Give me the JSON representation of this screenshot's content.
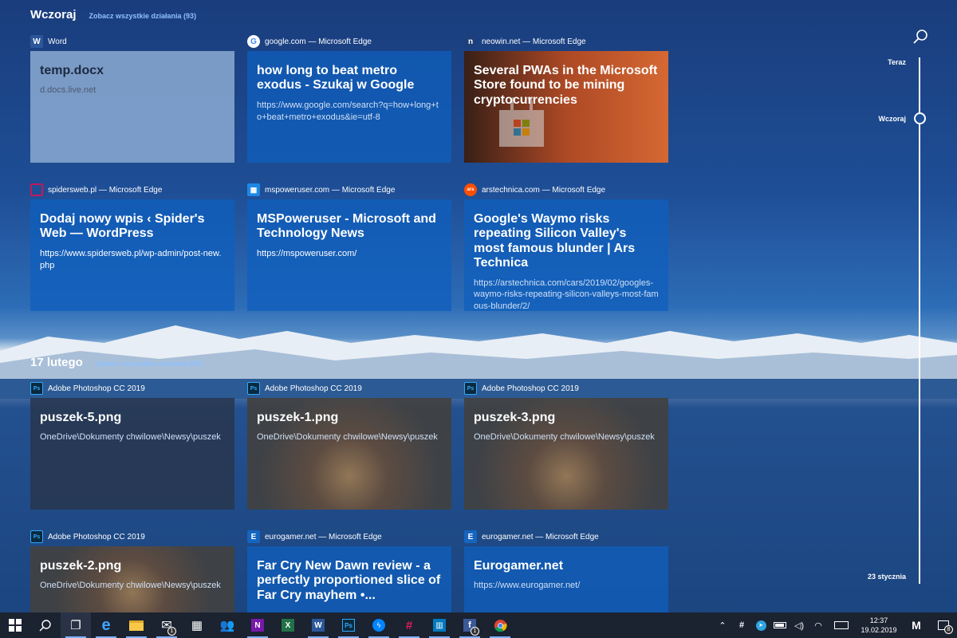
{
  "sections": [
    {
      "title": "Wczoraj",
      "see_all": "Zobacz wszystkie działania (93)"
    },
    {
      "title": "17 lutego",
      "see_all": "Zobacz wszystkie działania (50)"
    }
  ],
  "cards": [
    {
      "app": "Word",
      "title": "temp.docx",
      "sub": "d.docs.live.net"
    },
    {
      "app": "google.com — Microsoft Edge",
      "title": "how long to beat metro exodus - Szukaj w Google",
      "sub": "https://www.google.com/search?q=how+long+to+beat+metro+exodus&ie=utf-8"
    },
    {
      "app": "neowin.net — Microsoft Edge",
      "title": "Several PWAs in the Microsoft Store found to be mining cryptocurrencies",
      "sub": ""
    },
    {
      "app": "spidersweb.pl — Microsoft Edge",
      "title": "Dodaj nowy wpis ‹ Spider's Web — WordPress",
      "sub": "https://www.spidersweb.pl/wp-admin/post-new.php"
    },
    {
      "app": "mspoweruser.com — Microsoft Edge",
      "title": "MSPoweruser - Microsoft and Technology News",
      "sub": "https://mspoweruser.com/"
    },
    {
      "app": "arstechnica.com — Microsoft Edge",
      "title": "Google's Waymo risks repeating Silicon Valley's most famous blunder | Ars Technica",
      "sub": "https://arstechnica.com/cars/2019/02/googles-waymo-risks-repeating-silicon-valleys-most-famous-blunder/2/"
    },
    {
      "app": "Adobe Photoshop CC 2019",
      "title": "puszek-5.png",
      "sub": "OneDrive\\Dokumenty chwilowe\\Newsy\\puszek"
    },
    {
      "app": "Adobe Photoshop CC 2019",
      "title": "puszek-1.png",
      "sub": "OneDrive\\Dokumenty chwilowe\\Newsy\\puszek"
    },
    {
      "app": "Adobe Photoshop CC 2019",
      "title": "puszek-3.png",
      "sub": "OneDrive\\Dokumenty chwilowe\\Newsy\\puszek"
    },
    {
      "app": "Adobe Photoshop CC 2019",
      "title": "puszek-2.png",
      "sub": "OneDrive\\Dokumenty chwilowe\\Newsy\\puszek"
    },
    {
      "app": "eurogamer.net — Microsoft Edge",
      "title": "Far Cry New Dawn review - a perfectly proportioned slice of Far Cry mayhem •...",
      "sub": ""
    },
    {
      "app": "eurogamer.net — Microsoft Edge",
      "title": "Eurogamer.net",
      "sub": "https://www.eurogamer.net/"
    }
  ],
  "app_icons": {
    "word": {
      "glyph": "W",
      "color": "#2b579a"
    },
    "google": {
      "glyph": "G",
      "color": "#ffffff"
    },
    "neowin": {
      "glyph": "n",
      "color": "#1e3f7a"
    },
    "spidersweb": {
      "glyph": "□",
      "color": "#c2185b"
    },
    "mspoweruser": {
      "glyph": "▦",
      "color": "#1e88e5"
    },
    "arstechnica": {
      "glyph": "ars",
      "color": "#ff4e00"
    },
    "photoshop": {
      "glyph": "Ps",
      "color": "#0b2a3e"
    },
    "eurogamer": {
      "glyph": "E",
      "color": "#1565c0"
    }
  },
  "timeline": {
    "labels": [
      "Teraz",
      "Wczoraj",
      "23 stycznia"
    ]
  },
  "taskbar": {
    "items": [
      {
        "name": "start-icon",
        "glyph": "⊞"
      },
      {
        "name": "search-icon",
        "glyph": "⌕"
      },
      {
        "name": "task-view-icon",
        "glyph": "❐"
      },
      {
        "name": "edge-icon",
        "glyph": "e"
      },
      {
        "name": "file-explorer-icon",
        "glyph": "📁"
      },
      {
        "name": "mail-icon",
        "glyph": "✉",
        "badge": "1"
      },
      {
        "name": "calendar-icon",
        "glyph": "▦"
      },
      {
        "name": "people-icon",
        "glyph": "👥"
      },
      {
        "name": "onenote-icon",
        "glyph": "N"
      },
      {
        "name": "excel-icon",
        "glyph": "X"
      },
      {
        "name": "word-icon",
        "glyph": "W"
      },
      {
        "name": "photoshop-icon",
        "glyph": "Ps"
      },
      {
        "name": "messenger-icon",
        "glyph": "💬"
      },
      {
        "name": "slack-icon",
        "glyph": "#"
      },
      {
        "name": "trello-icon",
        "glyph": "▥"
      },
      {
        "name": "facebook-icon",
        "glyph": "f",
        "badge": "1"
      },
      {
        "name": "chrome-icon",
        "glyph": "◉"
      }
    ],
    "tray": [
      {
        "name": "chevron-up-icon",
        "glyph": "^"
      },
      {
        "name": "slack-tray-icon",
        "glyph": "#"
      },
      {
        "name": "telegram-tray-icon",
        "glyph": "➤"
      },
      {
        "name": "battery-icon",
        "glyph": "▭"
      },
      {
        "name": "volume-icon",
        "glyph": "🔊"
      },
      {
        "name": "wifi-icon",
        "glyph": "≋"
      },
      {
        "name": "keyboard-icon",
        "glyph": "⌨"
      }
    ],
    "time": "12:37",
    "date": "19.02.2019",
    "notification_count": "8"
  }
}
